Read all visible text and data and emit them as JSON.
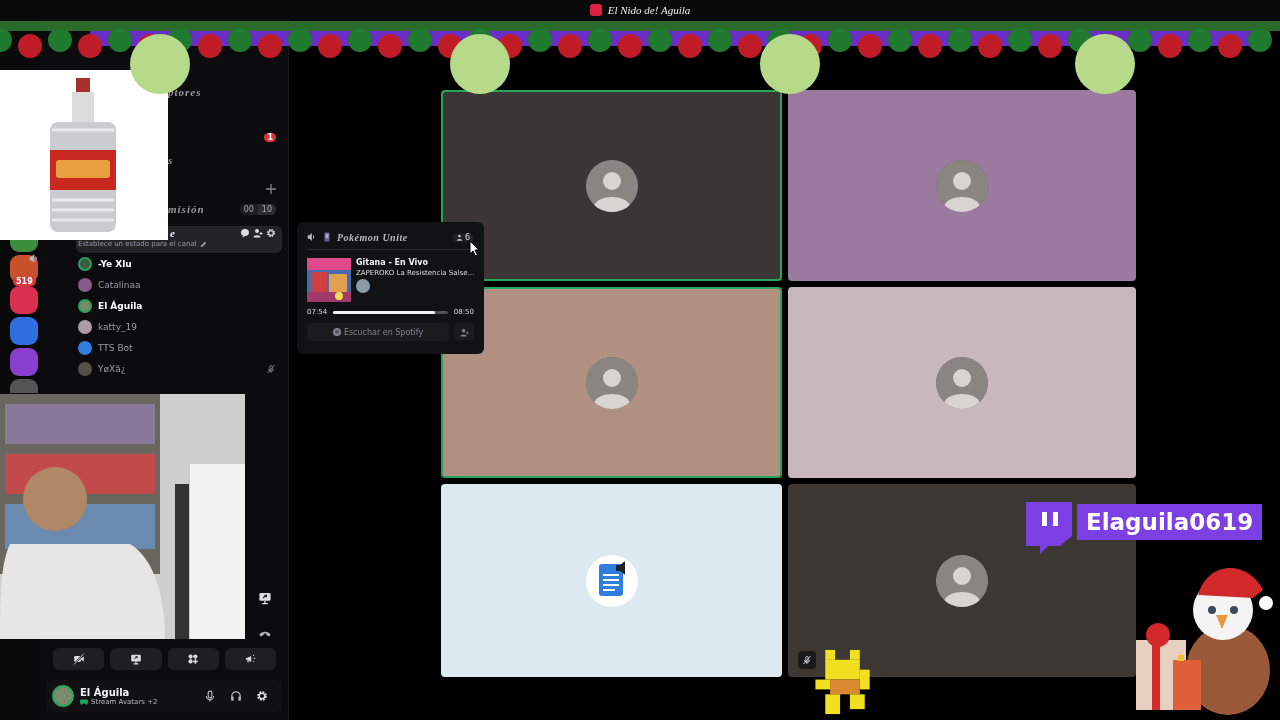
{
  "title_bar": {
    "title": "El Nido de! Aguila"
  },
  "servers": [
    {
      "color": "#3c8d3c",
      "audio": false
    },
    {
      "color": "#c8502a",
      "audio": true,
      "badge": "519"
    },
    {
      "color": "#d9304f",
      "audio": false
    },
    {
      "color": "#2f6fe0",
      "audio": false
    },
    {
      "color": "#8a3fd1",
      "audio": false
    },
    {
      "color": "#555555",
      "audio": false
    }
  ],
  "sidebar": {
    "category_1": "ptores",
    "unread_badge": "1",
    "category_2": "s",
    "channel_1": {
      "name": "misión",
      "user_count": "00",
      "user_limit": "10"
    },
    "voice_channel": {
      "name": "e",
      "selected": true,
      "status_hint": "Establece un estado para el canal",
      "members": [
        {
          "name": "-Ye Xlu",
          "speaking": true,
          "muted": false,
          "color": "#3e5a3e"
        },
        {
          "name": "Catalinaa",
          "speaking": false,
          "muted": false,
          "color": "#8a5a8a"
        },
        {
          "name": "El Águila",
          "speaking": true,
          "muted": false,
          "color": "#7a8a6a"
        },
        {
          "name": "katty_19",
          "speaking": false,
          "muted": false,
          "color": "#b09aa8"
        },
        {
          "name": "TTS Bot",
          "speaking": false,
          "muted": false,
          "color": "#2f7fe0"
        },
        {
          "name": "YøXã¿",
          "speaking": false,
          "muted": true,
          "color": "#55504a"
        }
      ]
    }
  },
  "user_panel": {
    "name": "El Águila",
    "activity": "Stream Avatars +2"
  },
  "activity_popup": {
    "game": "Pokémon Unite",
    "listeners": "6",
    "track": "Gitana - En Vivo",
    "artist": "ZAPEROKO La Resistencia Salse…",
    "elapsed": "07:54",
    "duration": "08:50",
    "level": 0.89,
    "button": "Escuchar en Spotify"
  },
  "tiles": [
    {
      "kind": "avatar",
      "color": "#3b3535",
      "speaking": true,
      "muted": false
    },
    {
      "kind": "avatar",
      "color": "#9b7aa0",
      "speaking": false,
      "muted": false
    },
    {
      "kind": "avatar",
      "color": "#b09080",
      "speaking": true,
      "muted": false
    },
    {
      "kind": "avatar",
      "color": "#c9b8bb",
      "speaking": false,
      "muted": false
    },
    {
      "kind": "bot",
      "color": "#dde9f0",
      "speaking": false,
      "muted": false
    },
    {
      "kind": "avatar",
      "color": "#3d3833",
      "speaking": false,
      "muted": true
    }
  ],
  "twitch_badge": {
    "channel": "Elaguila0619"
  }
}
